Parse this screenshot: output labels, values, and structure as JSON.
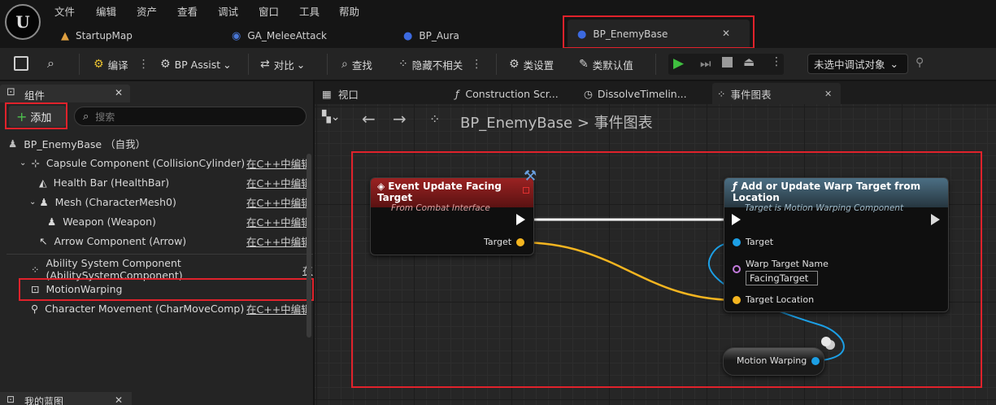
{
  "menu": [
    "文件",
    "编辑",
    "资产",
    "查看",
    "调试",
    "窗口",
    "工具",
    "帮助"
  ],
  "tabs": [
    "StartupMap",
    "GA_MeleeAttack",
    "BP_Aura",
    "BP_EnemyBase"
  ],
  "toolbar": {
    "compile": "编译",
    "bp_assist": "BP Assist",
    "diff": "对比",
    "find": "查找",
    "hide_unrelated": "隐藏不相关",
    "class_settings": "类设置",
    "class_defaults": "类默认值",
    "debug_target": "未选中调试对象"
  },
  "components": {
    "title": "组件",
    "add": "添加",
    "search_placeholder": "搜索",
    "self": "BP_EnemyBase （自我）",
    "items": [
      {
        "label": "Capsule Component (CollisionCylinder)",
        "edit": "在C++中编辑"
      },
      {
        "label": "Health Bar (HealthBar)",
        "edit": "在C++中编辑"
      },
      {
        "label": "Mesh (CharacterMesh0)",
        "edit": "在C++中编辑"
      },
      {
        "label": "Weapon (Weapon)",
        "edit": "在C++中编辑"
      },
      {
        "label": "Arrow Component (Arrow)",
        "edit": "在C++中编辑"
      },
      {
        "label": "Ability System Component (AbilitySystemComponent)",
        "edit": "在"
      },
      {
        "label": "MotionWarping",
        "edit": ""
      },
      {
        "label": "Character Movement (CharMoveComp)",
        "edit": "在C++中编辑"
      }
    ],
    "my_blueprint": "我的蓝图"
  },
  "graph_tabs": [
    "视口",
    "Construction Scr...",
    "DissolveTimelin...",
    "事件图表"
  ],
  "breadcrumb": {
    "bp": "BP_EnemyBase",
    "sep": ">",
    "graph": "事件图表"
  },
  "nodes": {
    "event": {
      "title": "Event Update Facing Target",
      "subtitle": "From Combat Interface",
      "pin_target": "Target"
    },
    "warp": {
      "title": "Add or Update Warp Target from Location",
      "subtitle": "Target is Motion Warping Component",
      "pin_target": "Target",
      "pin_name": "Warp Target Name",
      "name_value": "FacingTarget",
      "pin_location": "Target Location"
    },
    "mw": {
      "label": "Motion Warping"
    }
  },
  "colors": {
    "highlight": "#e0222b",
    "exec": "#ffffff",
    "object_pin": "#f4b520",
    "ref_pin": "#1c9fe5",
    "name_pin": "#c27adc",
    "event_header": "#8a1b1b",
    "func_header": "#3a5566"
  }
}
